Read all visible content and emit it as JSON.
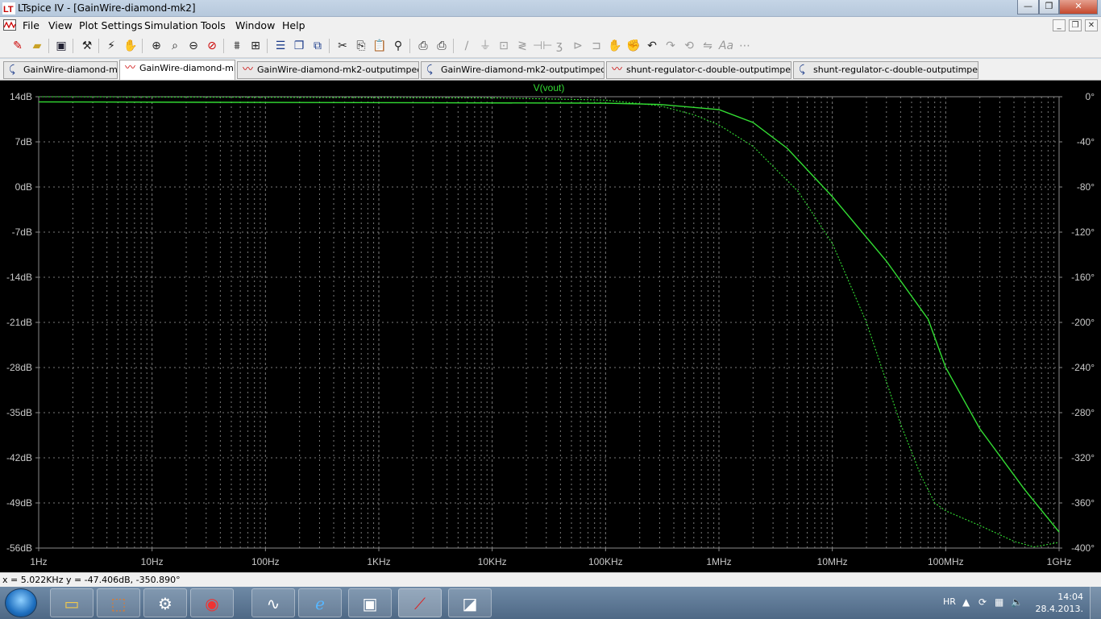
{
  "window": {
    "title": "LTspice IV - [GainWire-diamond-mk2]",
    "minimize": "—",
    "restore": "❐",
    "close": "✕"
  },
  "menu": [
    "File",
    "View",
    "Plot Settings",
    "Simulation",
    "Tools",
    "Window",
    "Help"
  ],
  "mdi_buttons": [
    "_",
    "❐",
    "✕"
  ],
  "toolbar_icons": [
    "new-schematic-icon",
    "open-icon",
    "save-icon",
    "control-panel-icon",
    "run-icon",
    "halt-icon",
    "zoom-in-icon",
    "zoom-full-icon",
    "zoom-out-icon",
    "zoom-cancel-icon",
    "autorange-icon",
    "grid-icon",
    "tile-horizontal-icon",
    "cascade-icon",
    "close-all-icon",
    "cut-icon",
    "copy-icon",
    "paste-icon",
    "find-icon",
    "print-preview-icon",
    "print-icon",
    "wire-icon",
    "ground-icon",
    "label-icon",
    "resistor-icon",
    "capacitor-icon",
    "inductor-icon",
    "diode-icon",
    "component-icon",
    "move-icon",
    "drag-icon",
    "undo-icon",
    "redo-icon",
    "rotate-icon",
    "mirror-icon",
    "text-icon",
    "spice-directive-icon"
  ],
  "tabs": [
    {
      "label": "GainWire-diamond-mk2",
      "kind": "schematic"
    },
    {
      "label": "GainWire-diamond-mk2",
      "kind": "waveform"
    },
    {
      "label": "GainWire-diamond-mk2-outputimpedance",
      "kind": "waveform"
    },
    {
      "label": "GainWire-diamond-mk2-outputimpedance",
      "kind": "schematic"
    },
    {
      "label": "shunt-regulator-c-double-outputimpedance",
      "kind": "waveform"
    },
    {
      "label": "shunt-regulator-c-double-outputimpedance",
      "kind": "schematic"
    }
  ],
  "colors": {
    "plot_bg": "#000000",
    "trace": "#33dd33",
    "axis_text": "#c8c8c8",
    "grid": "#7a7a7a"
  },
  "chart_data": {
    "type": "line",
    "title": "V(vout)",
    "x_scale": "log",
    "xlim": [
      1,
      1000000000
    ],
    "x_ticks": [
      "1Hz",
      "10Hz",
      "100Hz",
      "1KHz",
      "10KHz",
      "100KHz",
      "1MHz",
      "10MHz",
      "100MHz",
      "1GHz"
    ],
    "y_left_ticks": [
      "14dB",
      "7dB",
      "0dB",
      "-7dB",
      "-14dB",
      "-21dB",
      "-28dB",
      "-35dB",
      "-42dB",
      "-49dB",
      "-56dB"
    ],
    "ylim_left": [
      -56,
      14
    ],
    "y_right_ticks": [
      "0°",
      "-40°",
      "-80°",
      "-120°",
      "-160°",
      "-200°",
      "-240°",
      "-280°",
      "-320°",
      "-360°",
      "-400°"
    ],
    "ylim_right": [
      -400,
      0
    ],
    "grid": true,
    "series": [
      {
        "name": "magnitude",
        "axis": "left",
        "style": "solid",
        "x": [
          1,
          100000,
          300000,
          1000000,
          2000000,
          4000000,
          10000000,
          30000000,
          70000000,
          100000000,
          200000000,
          500000000,
          1000000000
        ],
        "y": [
          13.2,
          13.0,
          12.8,
          12.0,
          10.0,
          6.0,
          -1.5,
          -11.5,
          -20.5,
          -28.0,
          -37.5,
          -47.0,
          -53.5
        ]
      },
      {
        "name": "phase",
        "axis": "right",
        "style": "dotted",
        "x": [
          1,
          10000,
          100000,
          300000,
          600000,
          1000000,
          2000000,
          5000000,
          10000000,
          20000000,
          40000000,
          60000000,
          80000000,
          100000000,
          200000000,
          400000000,
          600000000,
          1000000000
        ],
        "y": [
          0,
          -1,
          -3,
          -8,
          -16,
          -25,
          -44,
          -84,
          -130,
          -200,
          -290,
          -335,
          -360,
          -367,
          -380,
          -394,
          -399,
          -395
        ]
      }
    ]
  },
  "status": {
    "readout": "x = 5.022KHz   y = -47.406dB, -350.890°"
  },
  "taskbar": {
    "apps": [
      "explorer-icon",
      "installer-icon",
      "tools-icon",
      "antivirus-icon",
      "oscilloscope-icon",
      "internet-explorer-icon",
      "photos-icon",
      "ltspice-icon",
      "document-icon"
    ],
    "lang": "HR",
    "time": "14:04",
    "date": "28.4.2013."
  }
}
